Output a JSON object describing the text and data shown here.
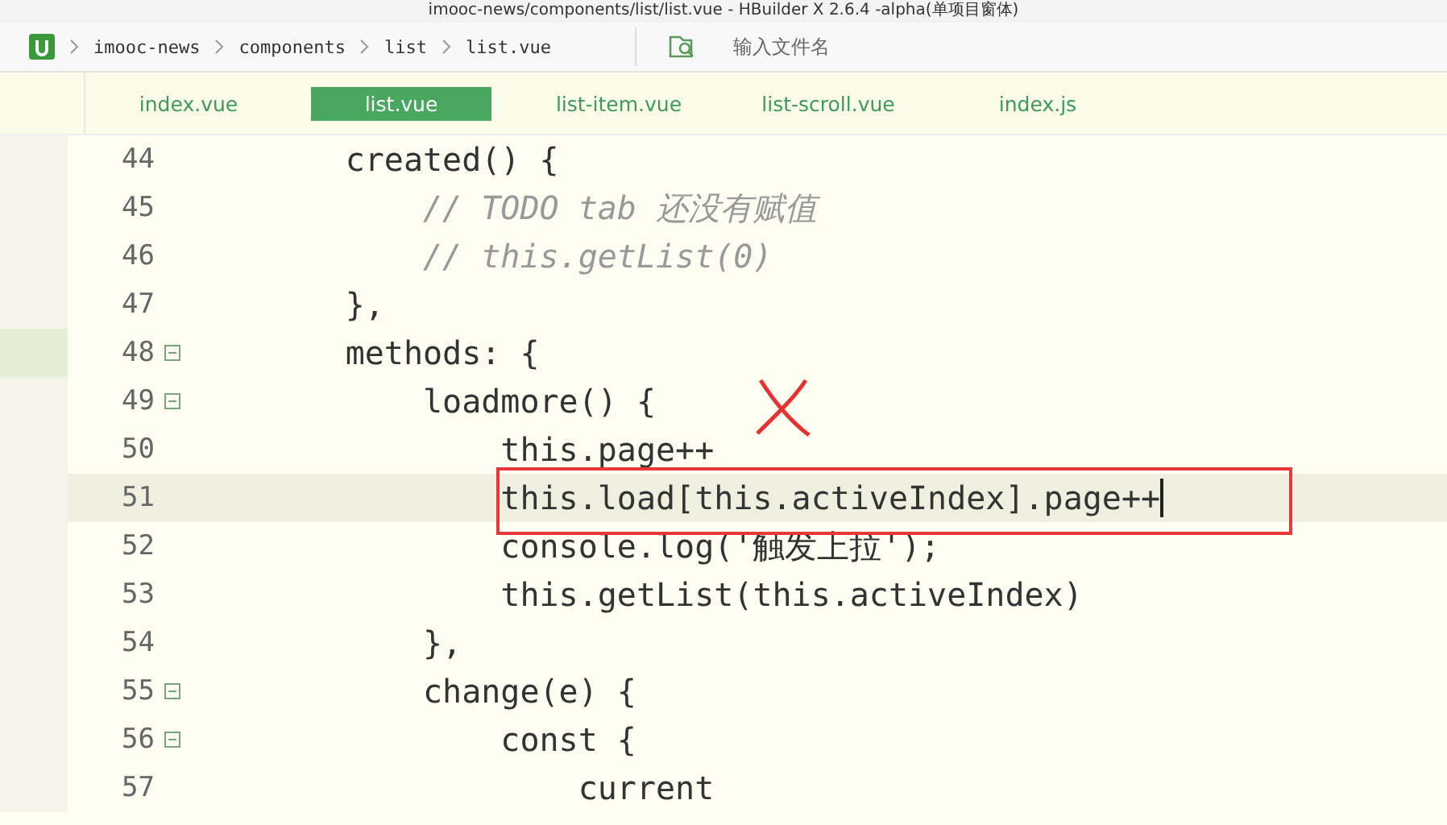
{
  "window": {
    "title": "imooc-news/components/list/list.vue - HBuilder X 2.6.4 -alpha(单项目窗体)"
  },
  "breadcrumb": [
    "imooc-news",
    "components",
    "list",
    "list.vue"
  ],
  "search": {
    "placeholder": "输入文件名"
  },
  "tabs": [
    {
      "label": "index.vue",
      "selected": false
    },
    {
      "label": "list.vue",
      "selected": true
    },
    {
      "label": "list-item.vue",
      "selected": false
    },
    {
      "label": "list-scroll.vue",
      "selected": false
    },
    {
      "label": "index.js",
      "selected": false
    }
  ],
  "code": [
    {
      "number": "44",
      "foldable": false,
      "current": false,
      "kind": "code",
      "text": "        created() {"
    },
    {
      "number": "45",
      "foldable": false,
      "current": false,
      "kind": "comment",
      "text": "            // TODO tab 还没有赋值"
    },
    {
      "number": "46",
      "foldable": false,
      "current": false,
      "kind": "comment",
      "text": "            // this.getList(0)"
    },
    {
      "number": "47",
      "foldable": false,
      "current": false,
      "kind": "code",
      "text": "        },"
    },
    {
      "number": "48",
      "foldable": true,
      "current": false,
      "kind": "code",
      "text": "        methods: {"
    },
    {
      "number": "49",
      "foldable": true,
      "current": false,
      "kind": "code",
      "text": "            loadmore() {"
    },
    {
      "number": "50",
      "foldable": false,
      "current": false,
      "kind": "code",
      "text": "                this.page++"
    },
    {
      "number": "51",
      "foldable": false,
      "current": true,
      "kind": "code",
      "text": "                this.load[this.activeIndex].page++"
    },
    {
      "number": "52",
      "foldable": false,
      "current": false,
      "kind": "code",
      "text": "                console.log('触发上拉');"
    },
    {
      "number": "53",
      "foldable": false,
      "current": false,
      "kind": "code",
      "text": "                this.getList(this.activeIndex)"
    },
    {
      "number": "54",
      "foldable": false,
      "current": false,
      "kind": "code",
      "text": "            },"
    },
    {
      "number": "55",
      "foldable": true,
      "current": false,
      "kind": "code",
      "text": "            change(e) {"
    },
    {
      "number": "56",
      "foldable": true,
      "current": false,
      "kind": "code",
      "text": "                const {"
    },
    {
      "number": "57",
      "foldable": false,
      "current": false,
      "kind": "code",
      "text": "                    current"
    }
  ]
}
